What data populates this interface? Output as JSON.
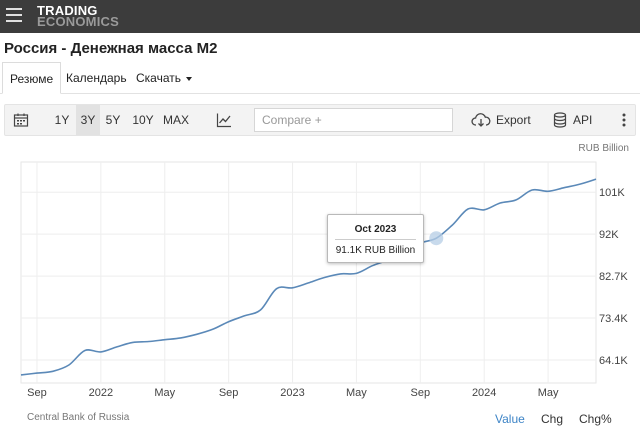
{
  "header": {
    "brand_line1": "TRADING",
    "brand_line2": "ECONOMICS"
  },
  "page_title": "Россия - Денежная масса M2",
  "tabs": [
    {
      "label": "Резюме",
      "active": true
    },
    {
      "label": "Календарь",
      "active": false
    },
    {
      "label": "Скачать",
      "active": false
    }
  ],
  "toolbar": {
    "ranges": [
      "1Y",
      "3Y",
      "5Y",
      "10Y",
      "MAX"
    ],
    "selected_range": "3Y",
    "compare_placeholder": "Compare +",
    "export_label": "Export",
    "api_label": "API"
  },
  "chart_data": {
    "type": "line",
    "unit_label": "RUB Billion",
    "x_ticks": [
      "Sep",
      "2022",
      "May",
      "Sep",
      "2023",
      "May",
      "Sep",
      "2024",
      "May"
    ],
    "y_ticks": [
      "64.1K",
      "73.4K",
      "82.7K",
      "92K",
      "101K"
    ],
    "ylim": [
      59000,
      108000
    ],
    "series": [
      {
        "name": "Денежная масса M2",
        "color": "#5b89b8",
        "x": [
          "2021-08",
          "2021-09",
          "2021-10",
          "2021-11",
          "2021-12",
          "2022-01",
          "2022-02",
          "2022-03",
          "2022-04",
          "2022-05",
          "2022-06",
          "2022-07",
          "2022-08",
          "2022-09",
          "2022-10",
          "2022-11",
          "2022-12",
          "2023-01",
          "2023-02",
          "2023-03",
          "2023-04",
          "2023-05",
          "2023-06",
          "2023-07",
          "2023-08",
          "2023-09",
          "2023-10",
          "2023-11",
          "2023-12",
          "2024-01",
          "2024-02",
          "2024-03",
          "2024-04",
          "2024-05",
          "2024-06",
          "2024-07",
          "2024-08"
        ],
        "values": [
          60800,
          61200,
          61600,
          63000,
          66200,
          65900,
          67000,
          68000,
          68200,
          68600,
          69000,
          69800,
          70900,
          72600,
          73900,
          75200,
          79900,
          80100,
          81200,
          82400,
          83200,
          83300,
          85000,
          86300,
          87900,
          90000,
          91100,
          94000,
          97600,
          97400,
          98900,
          99600,
          101800,
          101500,
          102300,
          103100,
          104200
        ]
      }
    ],
    "tooltip": {
      "date": "Oct 2023",
      "value": "91.1K RUB Billion"
    },
    "source": "Central Bank of Russia"
  },
  "bottom_tabs": [
    {
      "label": "Value",
      "active": true
    },
    {
      "label": "Chg",
      "active": false
    },
    {
      "label": "Chg%",
      "active": false
    }
  ]
}
